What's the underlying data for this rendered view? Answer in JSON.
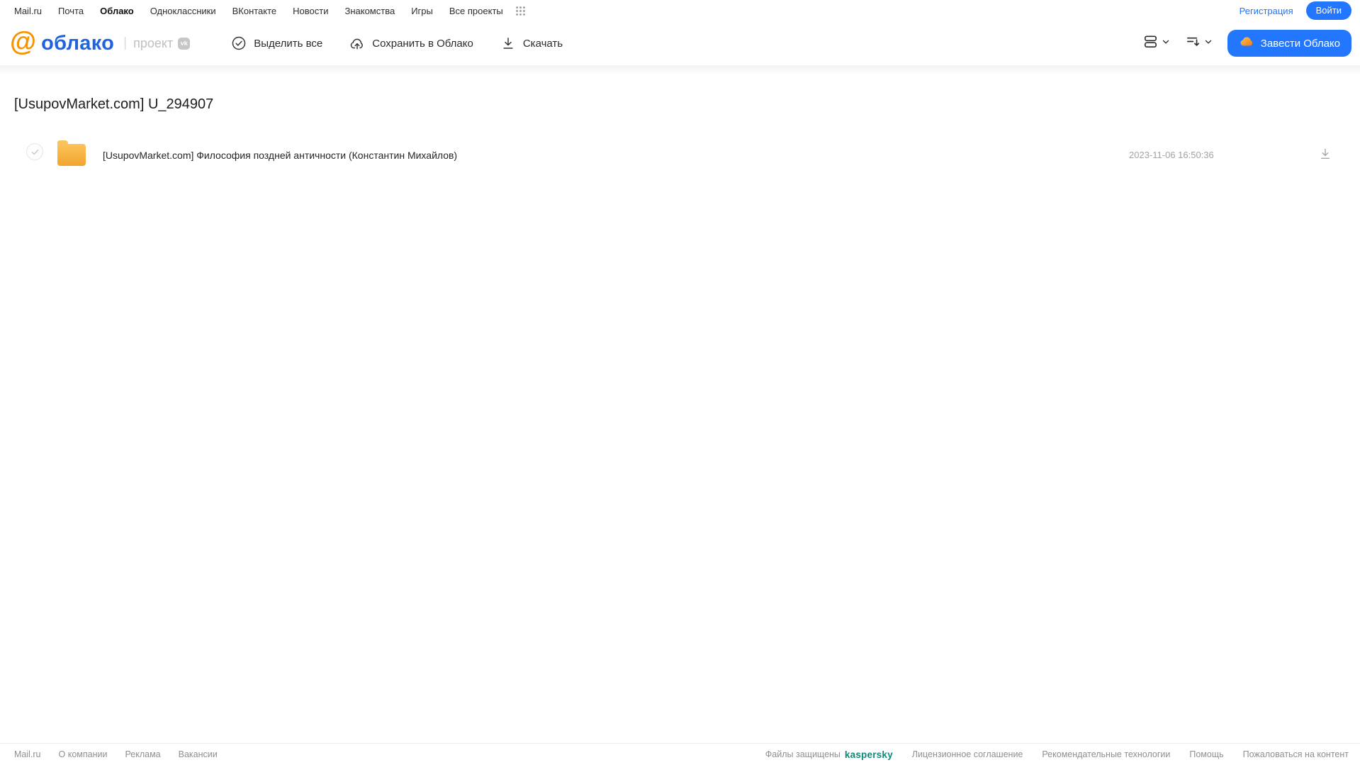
{
  "top_nav": {
    "items": [
      "Mail.ru",
      "Почта",
      "Облако",
      "Одноклассники",
      "ВКонтакте",
      "Новости",
      "Знакомства",
      "Игры",
      "Все проекты"
    ],
    "registration_label": "Регистрация",
    "login_label": "Войти"
  },
  "header": {
    "logo_at": "@",
    "logo_text": "облако",
    "project_label": "проект",
    "vk_badge": "vk",
    "actions": {
      "select_all": "Выделить все",
      "save_to_cloud": "Сохранить в Облако",
      "download": "Скачать"
    },
    "create_cloud_label": "Завести Облако"
  },
  "main": {
    "title": "[UsupovMarket.com] U_294907",
    "files": [
      {
        "type": "folder",
        "name": "[UsupovMarket.com] Философия поздней античности (Константин Михайлов)",
        "modified": "2023-11-06 16:50:36"
      }
    ]
  },
  "footer": {
    "left_links": [
      "Mail.ru",
      "О компании",
      "Реклама",
      "Вакансии"
    ],
    "protected_label": "Файлы защищены",
    "kaspersky_label": "kaspersky",
    "right_links": [
      "Лицензионное соглашение",
      "Рекомендательные технологии",
      "Помощь",
      "Пожаловаться на контент"
    ]
  },
  "colors": {
    "accent_blue": "#2377FF",
    "logo_blue": "#2163DF",
    "logo_orange": "#F59300",
    "folder_yellow": "#F7B23B",
    "kaspersky_teal": "#0E8A78"
  }
}
